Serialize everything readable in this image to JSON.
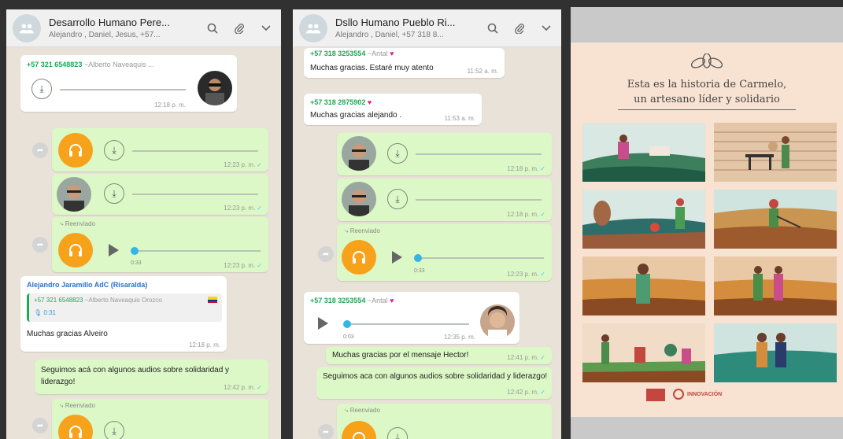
{
  "panel1": {
    "title": "Desarrollo Humano Pere...",
    "members": "Alejandro , Daniel, Jesus, +57...",
    "msg1": {
      "sender": "+57 321 6548823",
      "alias": "~Alberto Naveaquis ...",
      "time": "12:18 p. m."
    },
    "audio1_time": "12:23 p. m.",
    "audio2_time": "12:23 p. m.",
    "forwarded": "Reenviado",
    "audio3_duration": "0:33",
    "audio3_time": "12:23 p. m.",
    "msg4": {
      "sender": "Alejandro Jaramillo AdC (Risaralda)",
      "quote_sender": "+57 321 6548823",
      "quote_alias": "~Alberto Naveaquis Orozco",
      "quote_text": "0:31",
      "text": "Muchas gracias Alveiro",
      "time": "12:18 p. m."
    },
    "msg5": {
      "text": "Seguimos acá con algunos audios sobre solidaridad y liderazgo!",
      "time": "12:42 p. m."
    },
    "forwarded2": "Reenviado"
  },
  "panel2": {
    "title": "Dsllo Humano Pueblo Ri...",
    "members": "Alejandro , Daniel, +57 318 8...",
    "msg1": {
      "sender": "+57 318 3253554",
      "alias": "~Antal",
      "text": "Muchas gracias. Estaré muy atento",
      "time": "11:52 a. m."
    },
    "msg2": {
      "sender": "+57 318 2875902",
      "text": "Muchas gracias alejando .",
      "time": "11:53 a. m."
    },
    "audio1_time": "12:18 p. m.",
    "audio2_time": "12:18 p. m.",
    "forwarded": "Reenviado",
    "audio3_duration": "0:33",
    "audio3_time": "12:23 p. m.",
    "msg3": {
      "sender": "+57 318 3253554",
      "alias": "~Antal",
      "duration": "0:03",
      "time": "12:35 p. m."
    },
    "msg4": {
      "text": "Muchas gracias por el mensaje Hector!",
      "time": "12:41 p. m."
    },
    "msg5": {
      "text": "Seguimos aca con algunos audios sobre solidaridad y liderazgo!",
      "time": "12:42 p. m."
    },
    "forwarded2": "Reenviado"
  },
  "poster": {
    "title_line1": "Esta es la historia de Carmelo,",
    "title_line2": "un artesano líder y solidario",
    "footer_text": "INNOVACIÓN"
  },
  "colors": {
    "orange": "#f7a21b",
    "green_bubble": "#dcf8c6",
    "sender_green": "#1fa855"
  }
}
